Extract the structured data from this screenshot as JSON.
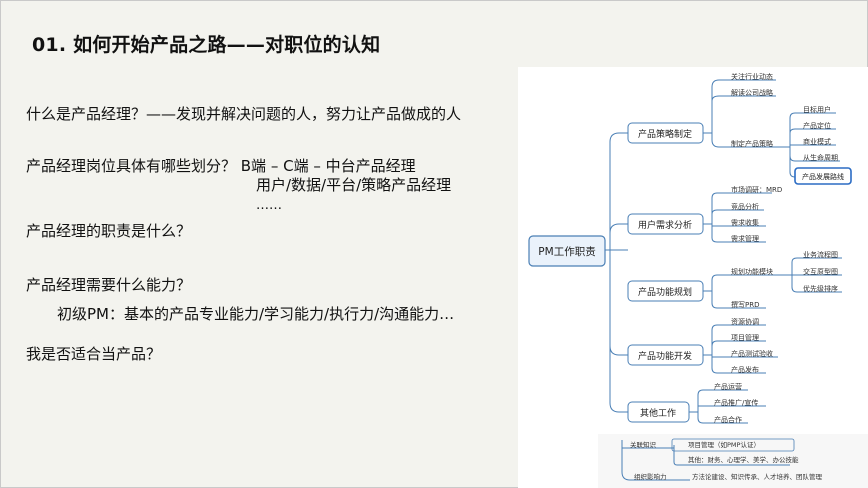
{
  "slide": {
    "title": "01. 如何开始产品之路——对职位的认知",
    "lines": [
      "什么是产品经理？——发现并解决问题的人，努力让产品做成的人",
      "产品经理岗位具体有哪些划分？ B端 – C端 – 中台产品经理",
      "用户/数据/平台/策略产品经理",
      "……",
      "产品经理的职责是什么？",
      "产品经理需要什么能力？",
      "初级PM：基本的产品专业能力/学习能力/执行力/沟通能力…",
      "我是否适合当产品？"
    ]
  },
  "mindmap": {
    "root": "PM工作职责",
    "branches": [
      {
        "label": "产品策略制定",
        "children": [
          "关注行业动态",
          "解读公司战略",
          "制定产品策略"
        ]
      },
      {
        "label": "用户需求分析",
        "children": [
          "市场调研：MRD",
          "竞品分析",
          "需求收集",
          "需求管理"
        ]
      },
      {
        "label": "产品功能规划",
        "children": [
          "规划功能模块",
          "撰写PRD"
        ]
      },
      {
        "label": "产品功能开发",
        "children": [
          "资源协调",
          "项目管理",
          "产品测试验收",
          "产品发布"
        ]
      },
      {
        "label": "其他工作",
        "children": [
          "产品运营",
          "产品推广/宣传",
          "产品合作"
        ]
      }
    ],
    "strategy_sub": [
      "目标用户",
      "产品定位",
      "商业模式",
      "从生命周期",
      "产品发展路线"
    ],
    "module_sub": [
      "业务流程图",
      "交互原型图",
      "优先级排序"
    ],
    "bottom": {
      "knowledge_label": "关联知识",
      "knowledge_items": [
        "项目管理（如PMP认证）",
        "其他：财务、心理学、美学、办公技能"
      ],
      "influence_label": "组织影响力",
      "influence_text": "方法论建设、知识传承、人才培养、团队管理"
    }
  }
}
